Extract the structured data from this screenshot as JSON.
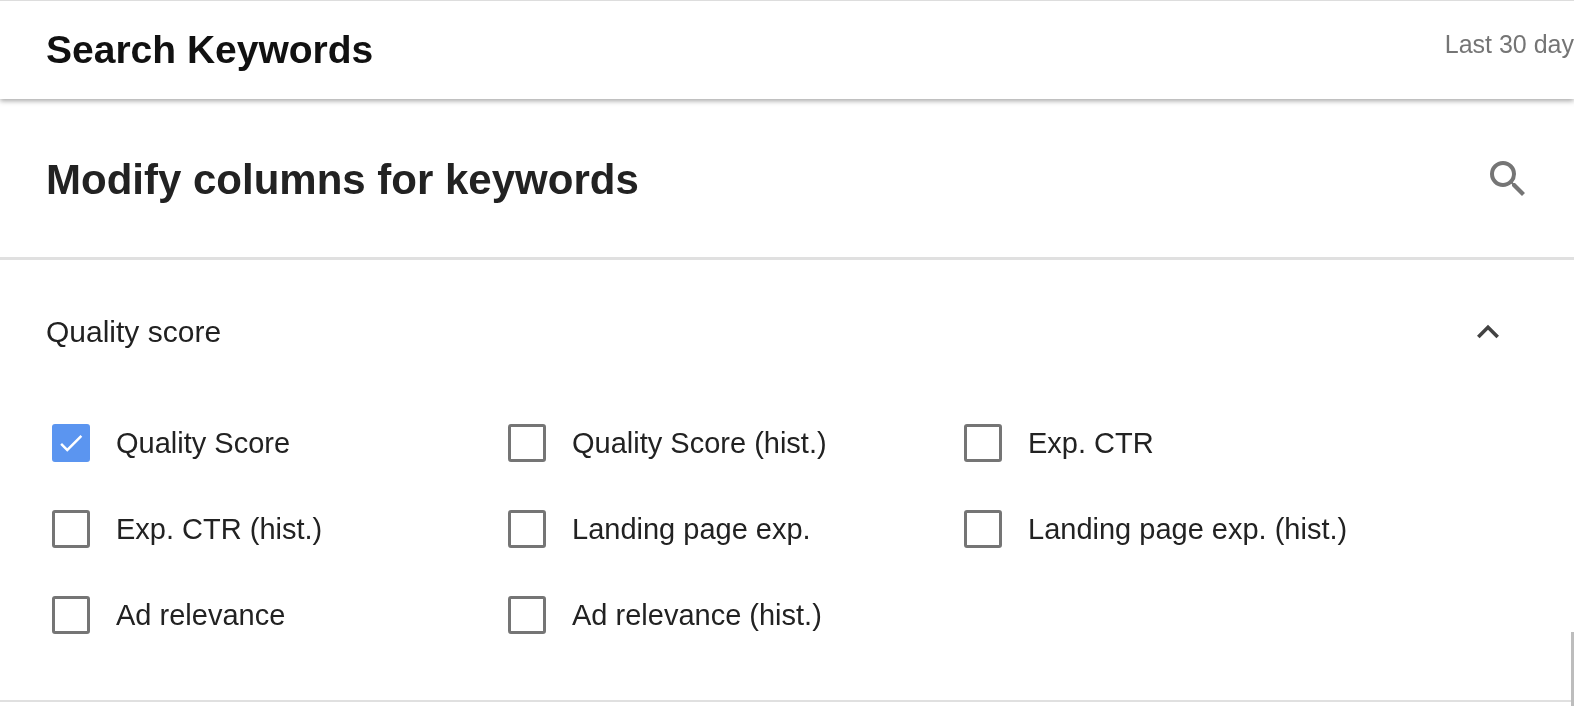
{
  "header": {
    "title": "Search Keywords",
    "date_range": "Last 30 day"
  },
  "panel": {
    "title": "Modify columns for keywords",
    "section": {
      "title": "Quality score",
      "expanded": true,
      "options": [
        {
          "label": "Quality Score",
          "checked": true
        },
        {
          "label": "Quality Score (hist.)",
          "checked": false
        },
        {
          "label": "Exp. CTR",
          "checked": false
        },
        {
          "label": "Exp. CTR (hist.)",
          "checked": false
        },
        {
          "label": "Landing page exp.",
          "checked": false
        },
        {
          "label": "Landing page exp. (hist.)",
          "checked": false
        },
        {
          "label": "Ad relevance",
          "checked": false
        },
        {
          "label": "Ad relevance (hist.)",
          "checked": false
        }
      ]
    }
  }
}
